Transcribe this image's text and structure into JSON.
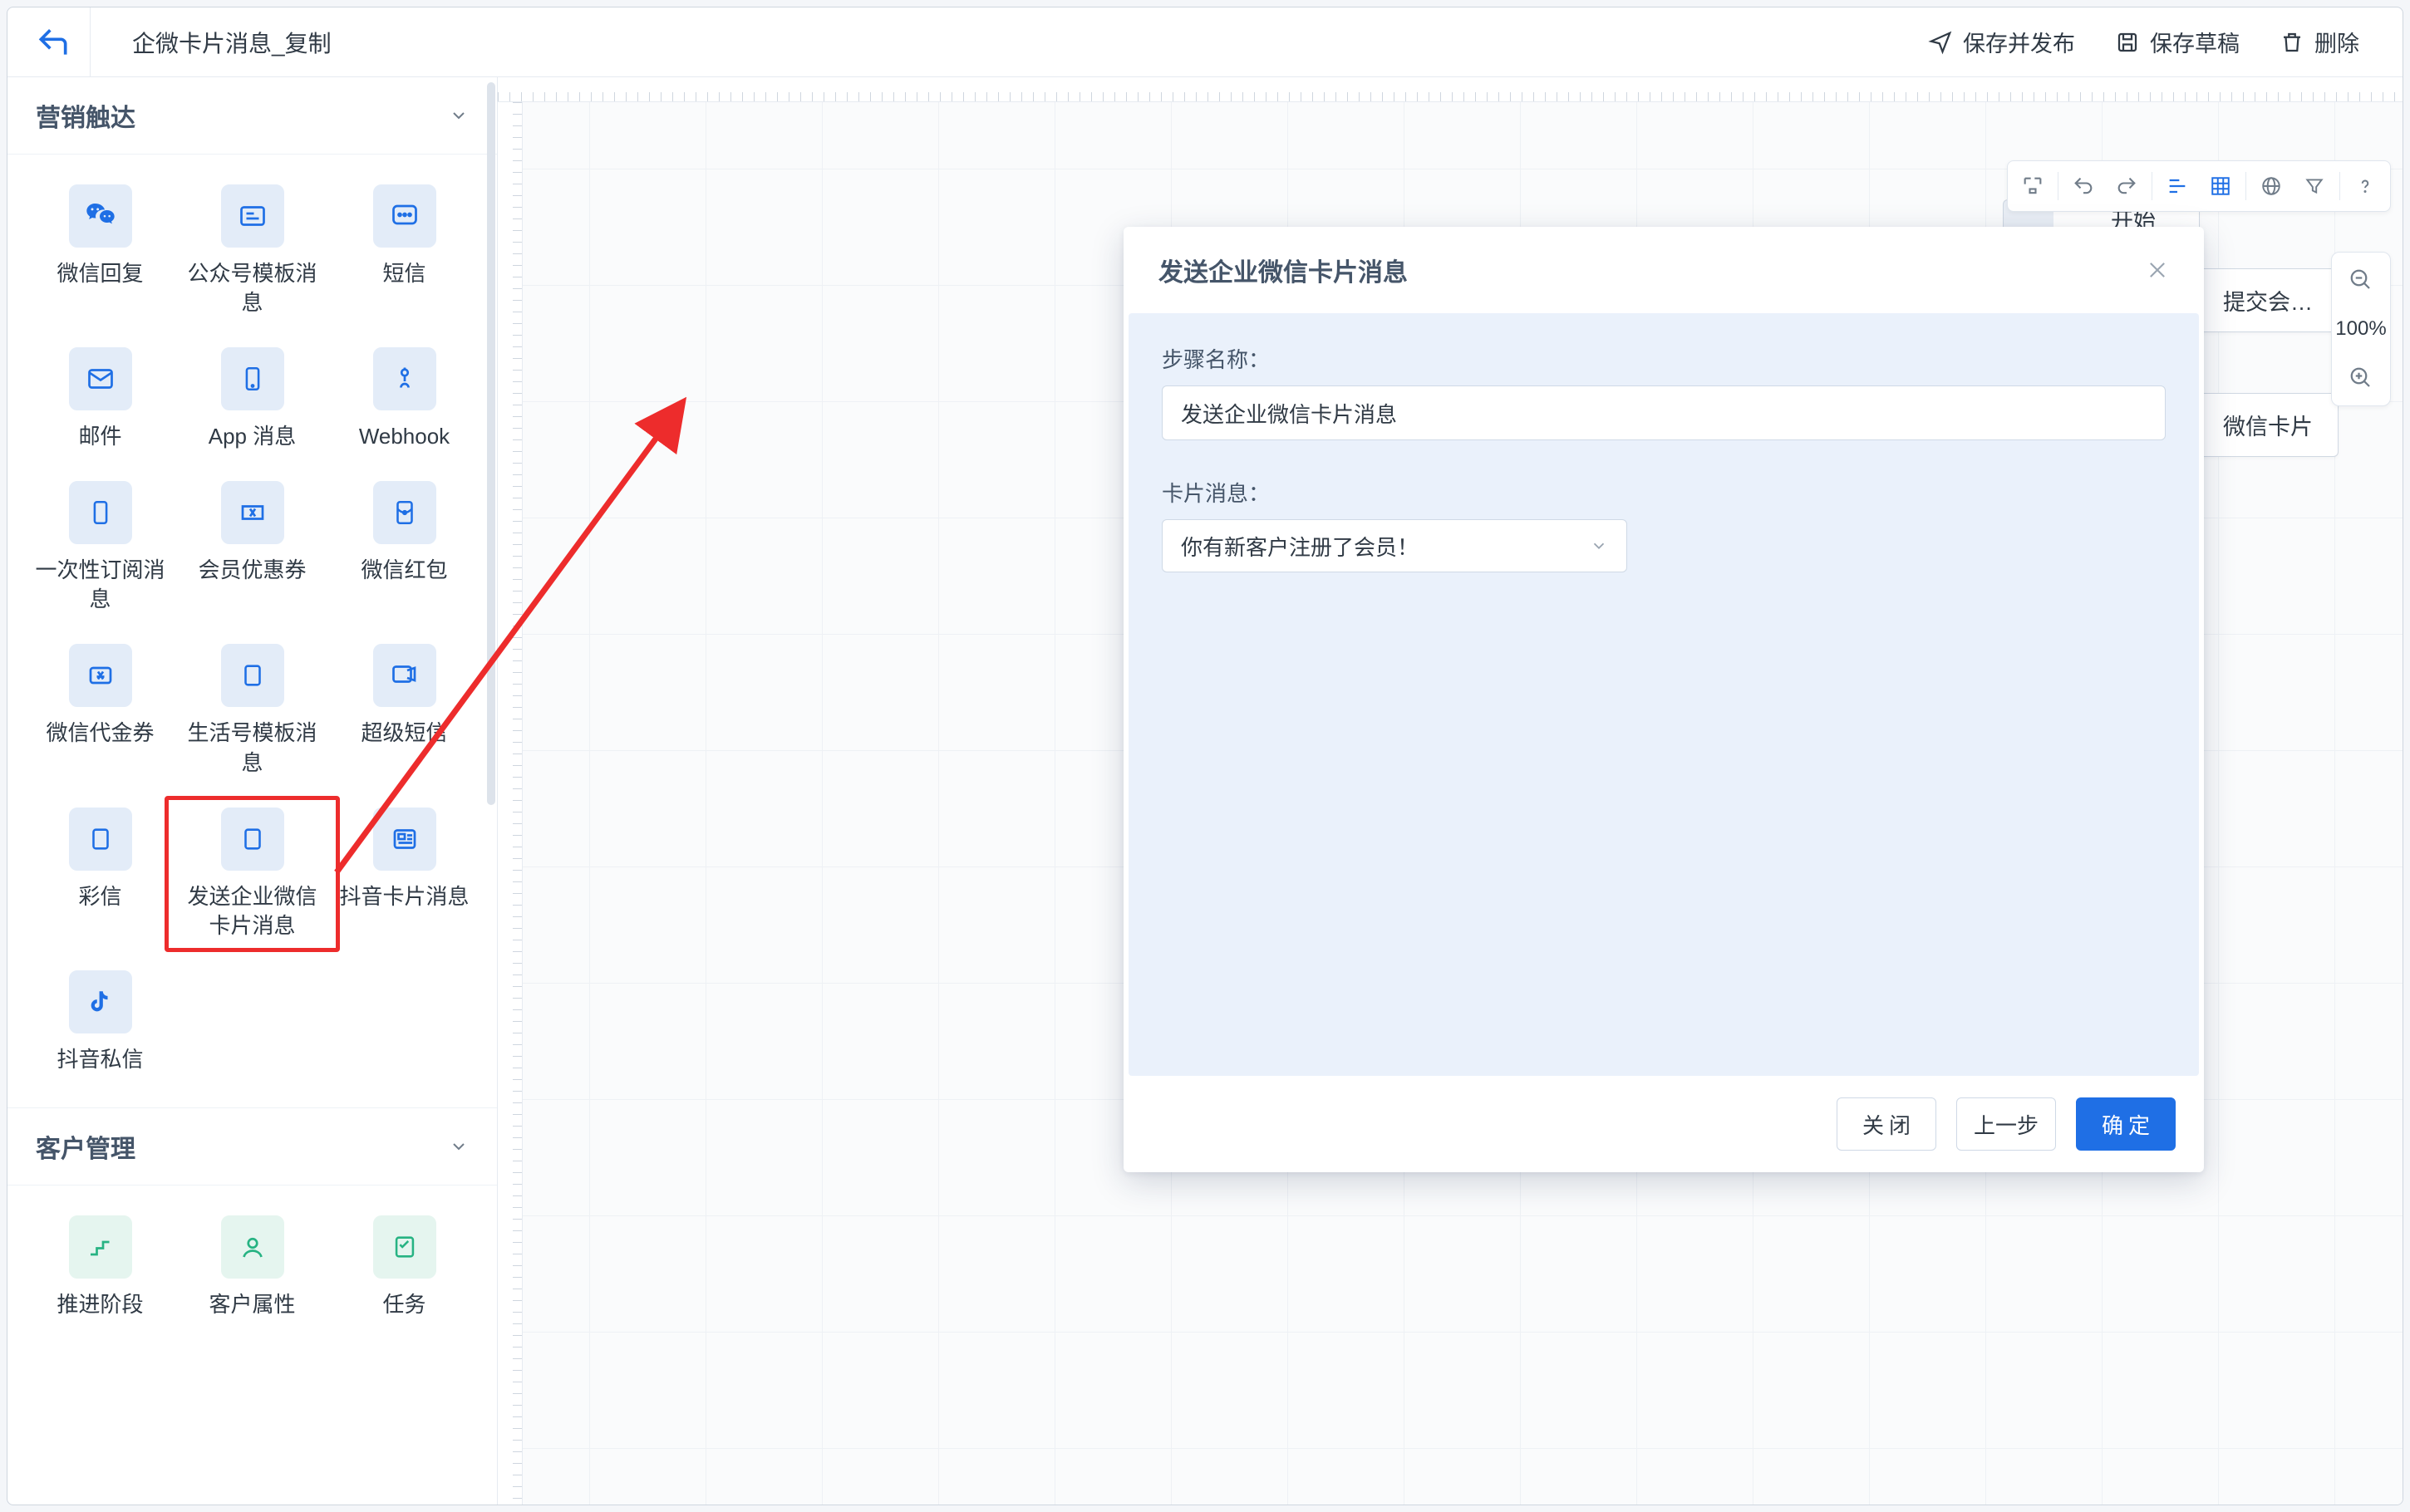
{
  "header": {
    "title": "企微卡片消息_复制",
    "actions": {
      "publish": "保存并发布",
      "draft": "保存草稿",
      "delete": "删除"
    }
  },
  "sidebar": {
    "marketing": {
      "title": "营销触达",
      "items": [
        {
          "id": "wechat-reply",
          "label": "微信回复"
        },
        {
          "id": "mp-template",
          "label": "公众号模板消息"
        },
        {
          "id": "sms",
          "label": "短信"
        },
        {
          "id": "email",
          "label": "邮件"
        },
        {
          "id": "app-message",
          "label": "App 消息"
        },
        {
          "id": "webhook",
          "label": "Webhook"
        },
        {
          "id": "one-time-sub",
          "label": "一次性订阅消息"
        },
        {
          "id": "member-coupon",
          "label": "会员优惠券"
        },
        {
          "id": "wechat-redpacket",
          "label": "微信红包"
        },
        {
          "id": "wechat-voucher",
          "label": "微信代金券"
        },
        {
          "id": "alipay-life",
          "label": "生活号模板消息"
        },
        {
          "id": "super-sms",
          "label": "超级短信"
        },
        {
          "id": "mms",
          "label": "彩信"
        },
        {
          "id": "wecom-card",
          "label": "发送企业微信卡片消息"
        },
        {
          "id": "douyin-card",
          "label": "抖音卡片消息"
        },
        {
          "id": "douyin-dm",
          "label": "抖音私信"
        }
      ],
      "highlighted_index": 13
    },
    "customer": {
      "title": "客户管理",
      "items": [
        {
          "id": "push-stage",
          "label": "推进阶段"
        },
        {
          "id": "cust-attr",
          "label": "客户属性"
        },
        {
          "id": "task",
          "label": "任务"
        }
      ]
    }
  },
  "canvas": {
    "start": "开始",
    "frag1": "提交会…",
    "frag2": "微信卡片",
    "zoom": "100%"
  },
  "modal": {
    "title": "发送企业微信卡片消息",
    "step_name_label": "步骤名称",
    "step_name_value": "发送企业微信卡片消息",
    "card_msg_label": "卡片消息",
    "card_msg_value": "你有新客户注册了会员！",
    "close": "关闭",
    "prev": "上一步",
    "confirm": "确定"
  }
}
